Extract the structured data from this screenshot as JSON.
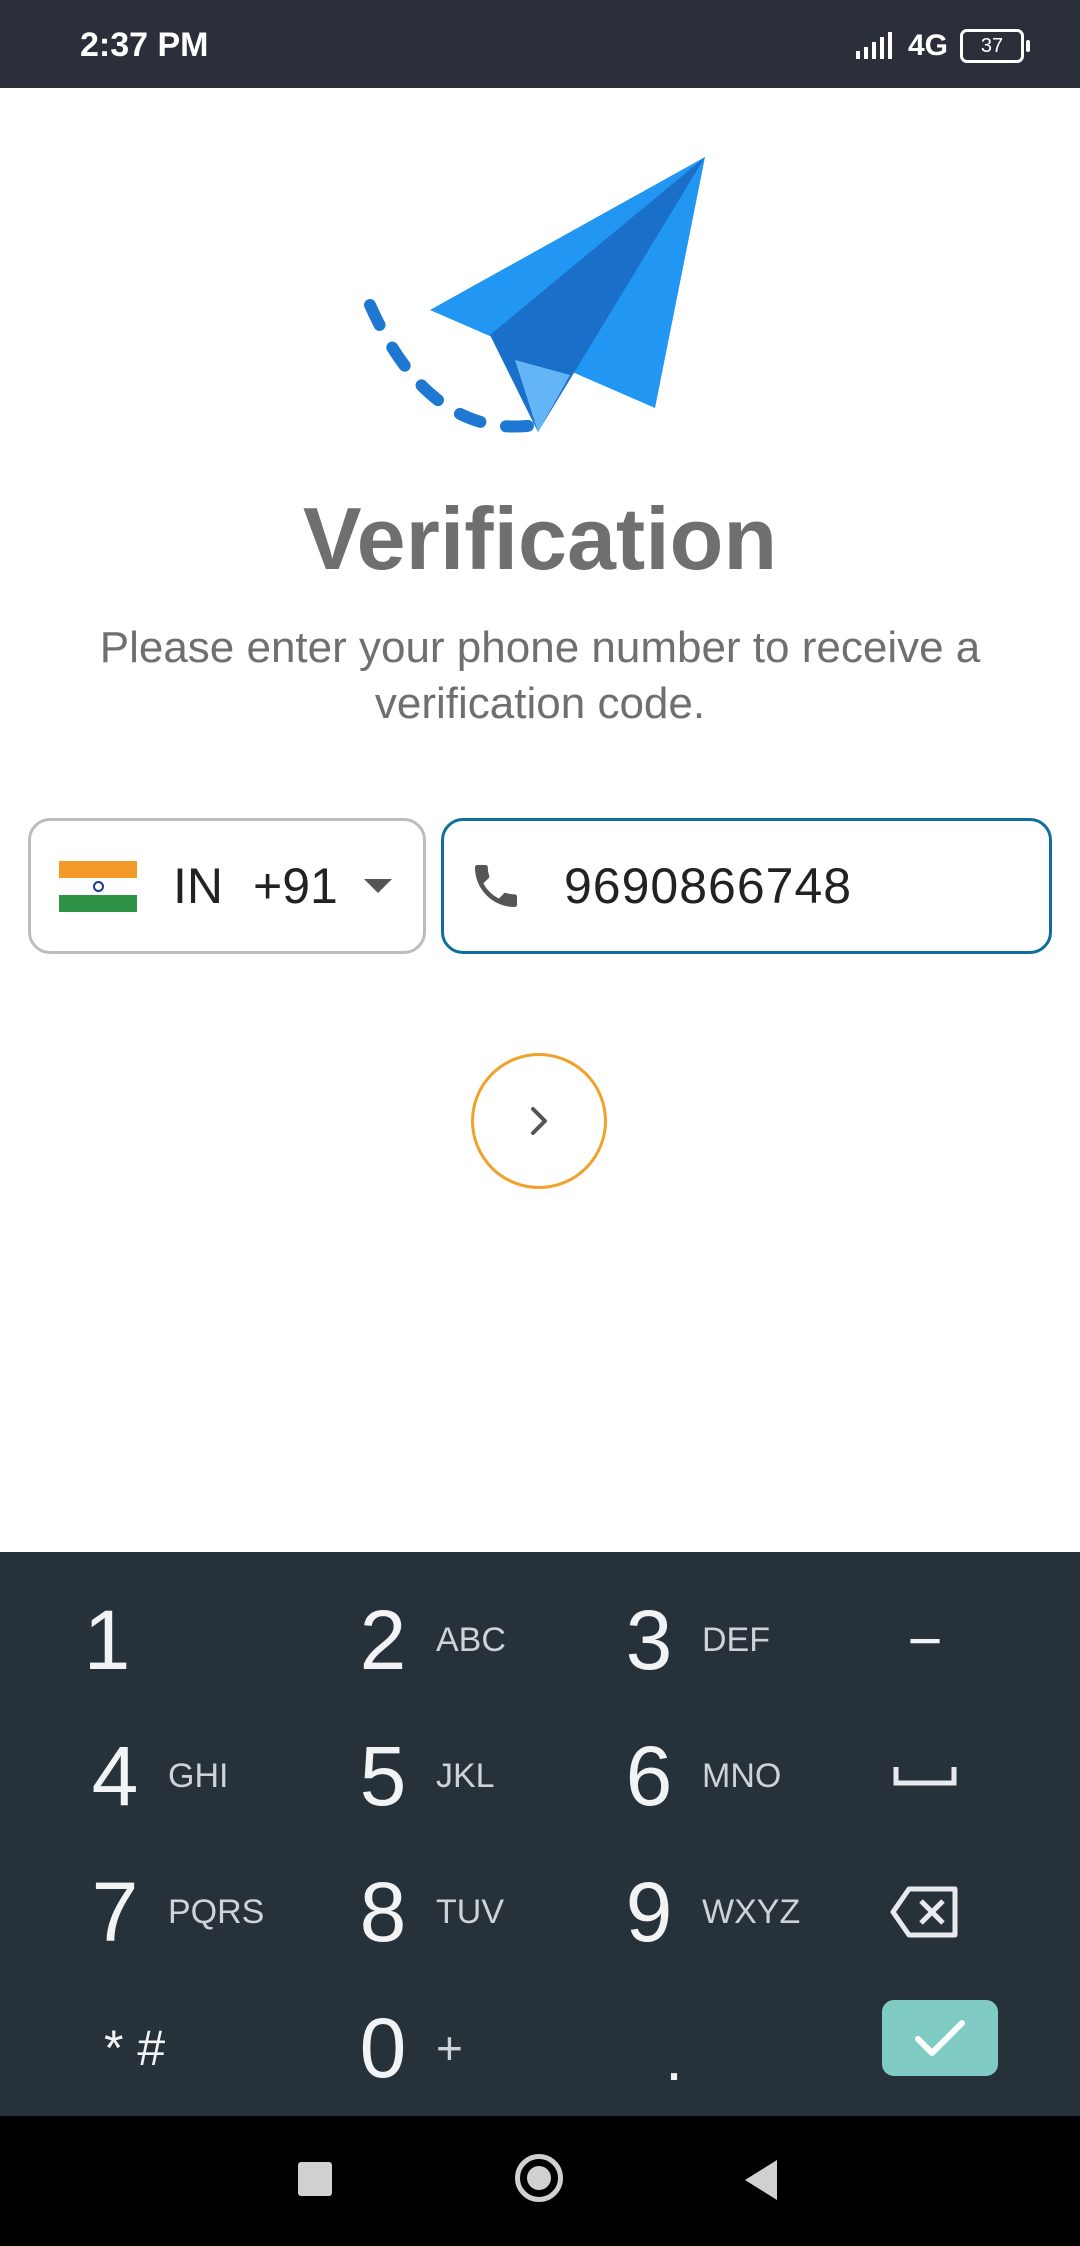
{
  "status_bar": {
    "time": "2:37 PM",
    "network": "4G",
    "battery": "37",
    "icons": [
      "signal-icon",
      "network-4g-icon",
      "battery-icon"
    ]
  },
  "hero": {
    "icon": "paper-plane-icon"
  },
  "title": "Verification",
  "subtitle": "Please enter your phone number to receive a verification code.",
  "country_select": {
    "flag": "india-flag-icon",
    "country_code": "IN",
    "dial_code": "+91"
  },
  "phone_input": {
    "icon": "phone-icon",
    "value": "9690866748"
  },
  "next_button": {
    "icon": "chevron-right-icon"
  },
  "keypad": {
    "keys": [
      {
        "digit": "1",
        "letters": ""
      },
      {
        "digit": "2",
        "letters": "ABC"
      },
      {
        "digit": "3",
        "letters": "DEF"
      },
      {
        "digit": "4",
        "letters": "GHI"
      },
      {
        "digit": "5",
        "letters": "JKL"
      },
      {
        "digit": "6",
        "letters": "MNO"
      },
      {
        "digit": "7",
        "letters": "PQRS"
      },
      {
        "digit": "8",
        "letters": "TUV"
      },
      {
        "digit": "9",
        "letters": "WXYZ"
      },
      {
        "digit": "0",
        "letters": "+"
      }
    ],
    "special": {
      "minus": "−",
      "star_hash": "* #",
      "period": "."
    },
    "icons": [
      "space-icon",
      "backspace-icon",
      "check-icon"
    ]
  },
  "colors": {
    "status_bar": "#2b2f3a",
    "plane_blue": "#2196f3",
    "field_border_active": "#0f6f9c",
    "next_button_border": "#f0a12a",
    "keypad_bg": "#27313a",
    "done_button": "#80cbc4"
  }
}
